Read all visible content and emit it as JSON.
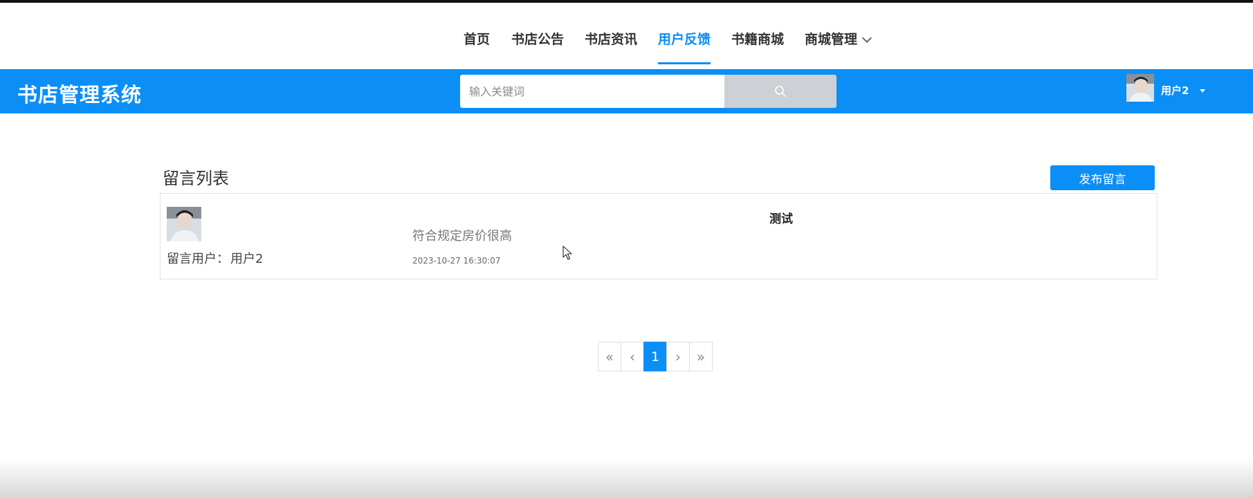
{
  "nav": {
    "items": [
      {
        "label": "首页"
      },
      {
        "label": "书店公告"
      },
      {
        "label": "书店资讯"
      },
      {
        "label": "用户反馈"
      },
      {
        "label": "书籍商城"
      },
      {
        "label": "商城管理"
      }
    ],
    "active_index": 3
  },
  "header": {
    "brand": "书店管理系统",
    "search": {
      "placeholder": "输入关键词",
      "value": ""
    },
    "search_icon": "search-icon",
    "user": {
      "name": "用户2"
    }
  },
  "main": {
    "title": "留言列表",
    "publish_label": "发布留言",
    "messages": [
      {
        "user_label": "留言用户：",
        "user": "用户2",
        "content": "符合规定房价很高",
        "time": "2023-10-27 16:30:07",
        "reply": "测试"
      }
    ]
  },
  "pagination": {
    "first": "«",
    "prev": "‹",
    "current": "1",
    "next": "›",
    "last": "»"
  },
  "colors": {
    "accent": "#0b8ef6",
    "search_button": "#cdd0d4"
  }
}
